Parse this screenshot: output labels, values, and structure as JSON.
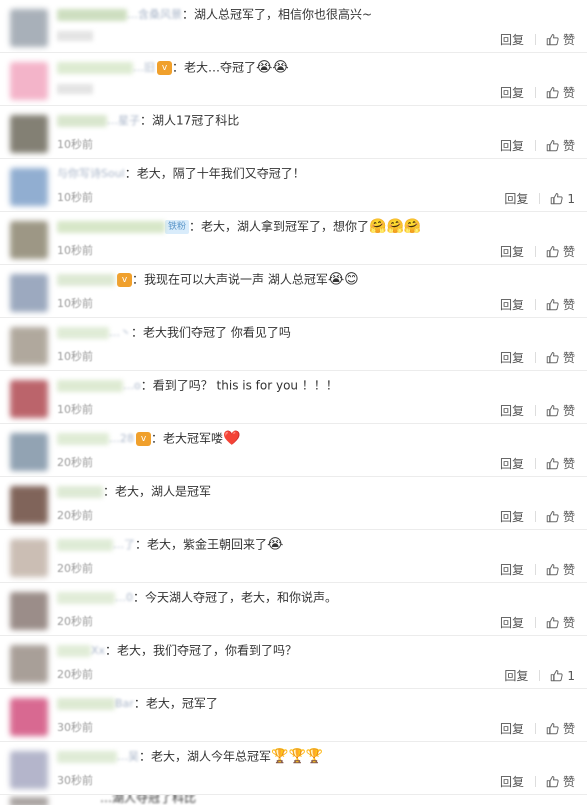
{
  "comments": [
    {
      "avatar_color": "#9aa3ad",
      "nick_color": "#b9d1a6",
      "nick_width": 70,
      "nick_tail": "…含桑风景",
      "badge": "",
      "fan_badge": "",
      "text": "：湖人总冠军了，相信你也很高兴~",
      "emoji": "",
      "time": "",
      "reply": "回复",
      "like": "赞"
    },
    {
      "avatar_color": "#f2a7c0",
      "nick_color": "#cfe3bf",
      "nick_width": 76,
      "nick_tail": "…旧",
      "badge": "vip",
      "fan_badge": "",
      "text": "：老大…夺冠了",
      "emoji": "😭😭",
      "time": "",
      "reply": "回复",
      "like": "赞"
    },
    {
      "avatar_color": "#6e6a5c",
      "nick_color": "#c9dcb9",
      "nick_width": 50,
      "nick_tail": "…星子",
      "badge": "",
      "fan_badge": "",
      "text": "：湖人17冠了科比",
      "emoji": "",
      "time": "10秒前",
      "reply": "回复",
      "like": "赞"
    },
    {
      "avatar_color": "#7ea0c9",
      "nick_color": "#ffffff",
      "nick_width": 0,
      "nick_tail": "与你写诗Soul",
      "badge": "",
      "fan_badge": "",
      "text": "：老大，隔了十年我们又夺冠了！",
      "emoji": "",
      "time": "10秒前",
      "reply": "回复",
      "like": "1"
    },
    {
      "avatar_color": "#8c8670",
      "nick_color": "#c7ddb2",
      "nick_width": 108,
      "nick_tail": "",
      "badge": "",
      "fan_badge": "铁粉",
      "text": "：老大，湖人拿到冠军了，想你了",
      "emoji": "🤗🤗🤗",
      "time": "10秒前",
      "reply": "回复",
      "like": "赞"
    },
    {
      "avatar_color": "#8b9bb4",
      "nick_color": "#cfe0c2",
      "nick_width": 58,
      "nick_tail": "",
      "badge": "vip",
      "fan_badge": "",
      "text": "：我现在可以大声说一声 湖人总冠军",
      "emoji": "😭😊",
      "time": "10秒前",
      "reply": "回复",
      "like": "赞"
    },
    {
      "avatar_color": "#a39a8d",
      "nick_color": "#d3e4c6",
      "nick_width": 52,
      "nick_tail": "…丶",
      "badge": "",
      "fan_badge": "",
      "text": "：老大我们夺冠了 你看见了吗",
      "emoji": "",
      "time": "10秒前",
      "reply": "回复",
      "like": "赞"
    },
    {
      "avatar_color": "#b04a52",
      "nick_color": "#d0e2c0",
      "nick_width": 66,
      "nick_tail": "…o",
      "badge": "",
      "fan_badge": "",
      "text": "：看到了吗？ this is for you ！！！",
      "emoji": "",
      "time": "10秒前",
      "reply": "回复",
      "like": "赞"
    },
    {
      "avatar_color": "#7f93a6",
      "nick_color": "#d2e4c4",
      "nick_width": 52,
      "nick_tail": "…28",
      "badge": "vip",
      "fan_badge": "",
      "text": "：老大冠军喽",
      "emoji": "❤️",
      "time": "20秒前",
      "reply": "回复",
      "like": "赞"
    },
    {
      "avatar_color": "#6b4a3e",
      "nick_color": "#d0e1c3",
      "nick_width": 46,
      "nick_tail": "",
      "badge": "",
      "fan_badge": "",
      "text": "：老大，湖人是冠军",
      "emoji": "",
      "time": "20秒前",
      "reply": "回复",
      "like": "赞"
    },
    {
      "avatar_color": "#c2b3a8",
      "nick_color": "#d1e3c5",
      "nick_width": 56,
      "nick_tail": "…了",
      "badge": "",
      "fan_badge": "",
      "text": "：老大，紫金王朝回来了",
      "emoji": "😭",
      "time": "20秒前",
      "reply": "回复",
      "like": "赞"
    },
    {
      "avatar_color": "#8a7a75",
      "nick_color": "#d5e5c8",
      "nick_width": 58,
      "nick_tail": "…0",
      "badge": "",
      "fan_badge": "",
      "text": "：今天湖人夺冠了，老大，和你说声。",
      "emoji": "",
      "time": "20秒前",
      "reply": "回复",
      "like": "赞"
    },
    {
      "avatar_color": "#9a8f87",
      "nick_color": "#d4e5c7",
      "nick_width": 34,
      "nick_tail": "Xx",
      "badge": "",
      "fan_badge": "",
      "text": "：老大，我们夺冠了，你看到了吗？",
      "emoji": "",
      "time": "20秒前",
      "reply": "回复",
      "like": "1"
    },
    {
      "avatar_color": "#d2507e",
      "nick_color": "#cfe1c0",
      "nick_width": 58,
      "nick_tail": "Bar",
      "badge": "",
      "fan_badge": "",
      "text": "：老大，冠军了",
      "emoji": "",
      "time": "30秒前",
      "reply": "回复",
      "like": "赞"
    },
    {
      "avatar_color": "#a7a9c2",
      "nick_color": "#d2e3c5",
      "nick_width": 60,
      "nick_tail": "…吴",
      "badge": "",
      "fan_badge": "",
      "text": "：老大，湖人今年总冠军",
      "emoji": "🏆🏆🏆",
      "time": "30秒前",
      "reply": "回复",
      "like": "赞"
    }
  ],
  "partial_row_text": "…湖人夺冠了科比"
}
